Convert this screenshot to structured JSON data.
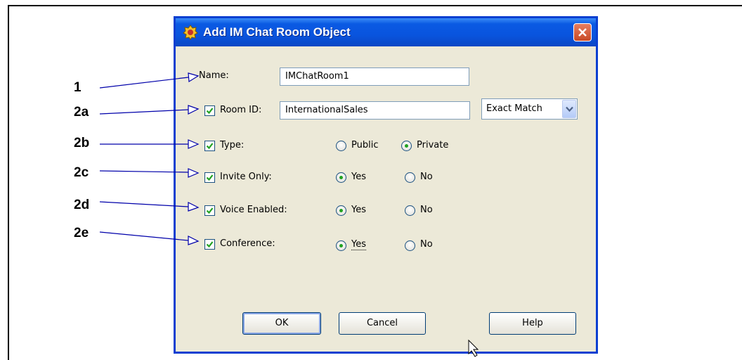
{
  "callouts": [
    "1",
    "2a",
    "2b",
    "2c",
    "2d",
    "2e"
  ],
  "dialog": {
    "title": "Add IM Chat Room Object",
    "name": {
      "label": "Name:",
      "value": "IMChatRoom1"
    },
    "room_id": {
      "label": "Room ID:",
      "checked": true,
      "value": "InternationalSales",
      "match_value": "Exact Match"
    },
    "type": {
      "label": "Type:",
      "checked": true,
      "options": [
        "Public",
        "Private"
      ],
      "selected": "Private"
    },
    "invite_only": {
      "label": "Invite Only:",
      "checked": true,
      "options": [
        "Yes",
        "No"
      ],
      "selected": "Yes"
    },
    "voice_enabled": {
      "label": "Voice Enabled:",
      "checked": true,
      "options": [
        "Yes",
        "No"
      ],
      "selected": "Yes"
    },
    "conference": {
      "label": "Conference:",
      "checked": true,
      "options": [
        "Yes",
        "No"
      ],
      "selected": "Yes"
    },
    "buttons": {
      "ok": "OK",
      "cancel": "Cancel",
      "help": "Help"
    }
  },
  "colors": {
    "titlebar": "#0a5ae3",
    "dialog_bg": "#ece9d8",
    "check": "#21a121",
    "arrow": "#0000aa"
  }
}
